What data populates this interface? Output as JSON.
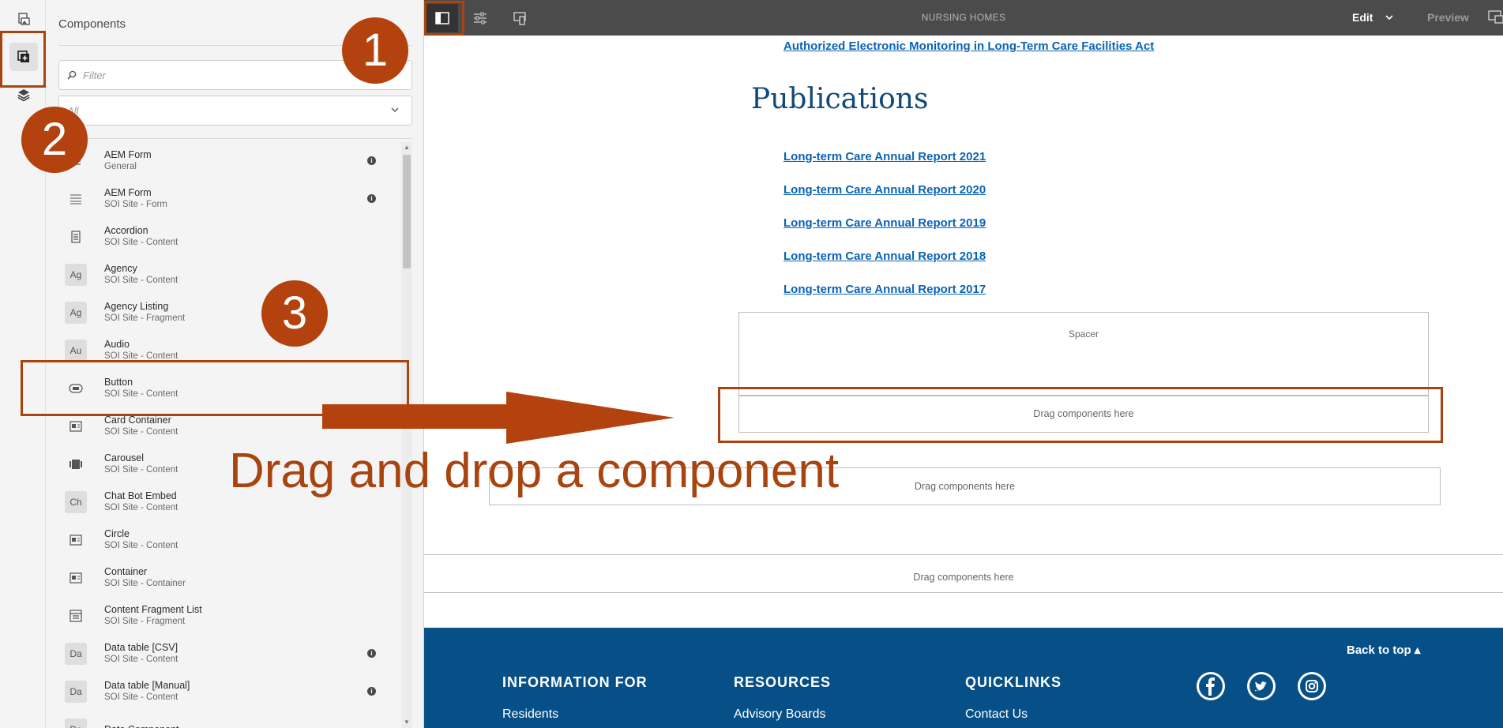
{
  "rail": {
    "items": [
      "assets-icon",
      "components-icon",
      "layers-icon"
    ]
  },
  "panel": {
    "title": "Components",
    "filter_placeholder": "Filter",
    "group_value": "All",
    "components": [
      {
        "name": "AEM Form",
        "group": "General",
        "icon": "text-bars",
        "info": true
      },
      {
        "name": "AEM Form",
        "group": "SOI Site - Form",
        "icon": "form-lines",
        "info": true
      },
      {
        "name": "Accordion",
        "group": "SOI Site - Content",
        "icon": "accordion",
        "info": false
      },
      {
        "name": "Agency",
        "group": "SOI Site - Content",
        "icon": "Ag",
        "info": false
      },
      {
        "name": "Agency Listing",
        "group": "SOI Site - Fragment",
        "icon": "Ag",
        "info": false
      },
      {
        "name": "Audio",
        "group": "SOI Site - Content",
        "icon": "Au",
        "info": false
      },
      {
        "name": "Button",
        "group": "SOI Site - Content",
        "icon": "button",
        "info": false
      },
      {
        "name": "Card Container",
        "group": "SOI Site - Content",
        "icon": "card",
        "info": false
      },
      {
        "name": "Carousel",
        "group": "SOI Site - Content",
        "icon": "carousel",
        "info": false
      },
      {
        "name": "Chat Bot Embed",
        "group": "SOI Site - Content",
        "icon": "Ch",
        "info": false
      },
      {
        "name": "Circle",
        "group": "SOI Site - Content",
        "icon": "card",
        "info": false
      },
      {
        "name": "Container",
        "group": "SOI Site - Container",
        "icon": "card",
        "info": false
      },
      {
        "name": "Content Fragment List",
        "group": "SOI Site - Fragment",
        "icon": "fragment-list",
        "info": false
      },
      {
        "name": "Data table [CSV]",
        "group": "SOI Site - Content",
        "icon": "Da",
        "info": true
      },
      {
        "name": "Data table [Manual]",
        "group": "SOI Site - Content",
        "icon": "Da",
        "info": true
      },
      {
        "name": "Date Component",
        "group": "",
        "icon": "Da",
        "info": false
      }
    ]
  },
  "toolbar": {
    "title": "NURSING HOMES",
    "edit_label": "Edit",
    "preview_label": "Preview"
  },
  "page": {
    "top_link": "Authorized Electronic Monitoring in Long-Term Care Facilities Act",
    "heading": "Publications",
    "report_links": [
      "Long-term Care Annual Report 2021",
      "Long-term Care Annual Report 2020",
      "Long-term Care Annual Report 2019",
      "Long-term Care Annual Report 2018",
      "Long-term Care Annual Report 2017"
    ],
    "spacer_label": "Spacer",
    "dropzone_label": "Drag components here"
  },
  "footer": {
    "back_to_top": "Back to top ▴",
    "columns": [
      {
        "heading": "INFORMATION FOR",
        "first_link": "Residents"
      },
      {
        "heading": "RESOURCES",
        "first_link": "Advisory Boards"
      },
      {
        "heading": "QUICKLINKS",
        "first_link": "Contact Us"
      }
    ],
    "social": [
      "facebook-icon",
      "twitter-icon",
      "instagram-icon"
    ]
  },
  "annotations": {
    "step1": "1",
    "step2": "2",
    "step3": "3",
    "caption": "Drag and drop a component",
    "color": "#a8440f"
  }
}
